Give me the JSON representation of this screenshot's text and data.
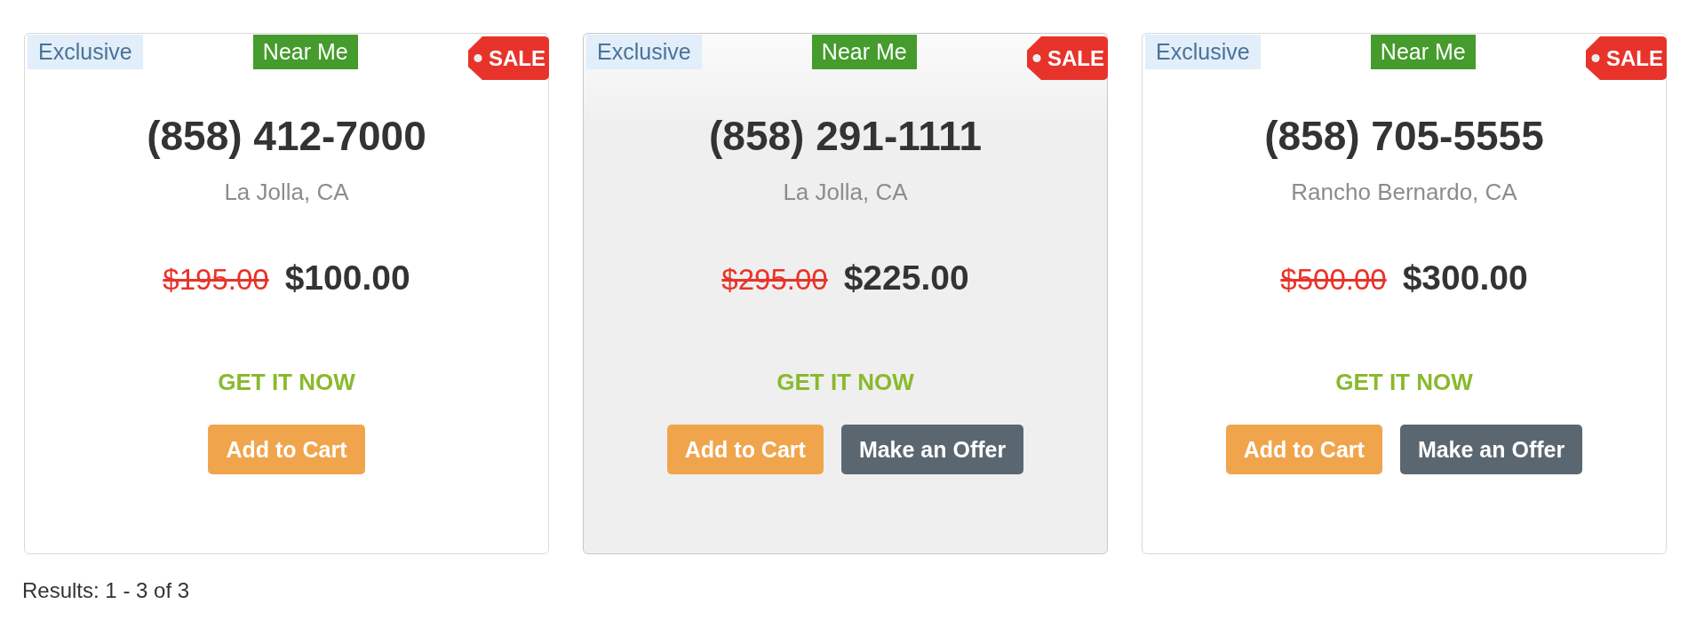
{
  "listings": [
    {
      "highlighted": false,
      "badges": [
        {
          "kind": "exclusive",
          "label": "Exclusive"
        },
        {
          "kind": "near_me",
          "label": "Near Me"
        },
        {
          "kind": "sale",
          "label": "SALE"
        }
      ],
      "phone": "(858) 412-7000",
      "location": "La Jolla, CA",
      "original_price": "$195.00",
      "price": "$100.00",
      "call_to_action": "GET IT NOW",
      "buttons": [
        {
          "kind": "cart",
          "label": "Add to Cart"
        }
      ]
    },
    {
      "highlighted": true,
      "badges": [
        {
          "kind": "exclusive",
          "label": "Exclusive"
        },
        {
          "kind": "near_me",
          "label": "Near Me"
        },
        {
          "kind": "sale",
          "label": "SALE"
        }
      ],
      "phone": "(858) 291-1111",
      "location": "La Jolla, CA",
      "original_price": "$295.00",
      "price": "$225.00",
      "call_to_action": "GET IT NOW",
      "buttons": [
        {
          "kind": "cart",
          "label": "Add to Cart"
        },
        {
          "kind": "offer",
          "label": "Make an Offer"
        }
      ]
    },
    {
      "highlighted": false,
      "badges": [
        {
          "kind": "exclusive",
          "label": "Exclusive"
        },
        {
          "kind": "near_me",
          "label": "Near Me"
        },
        {
          "kind": "sale",
          "label": "SALE"
        }
      ],
      "phone": "(858) 705-5555",
      "location": "Rancho Bernardo, CA",
      "original_price": "$500.00",
      "price": "$300.00",
      "call_to_action": "GET IT NOW",
      "buttons": [
        {
          "kind": "cart",
          "label": "Add to Cart"
        },
        {
          "kind": "offer",
          "label": "Make an Offer"
        }
      ]
    }
  ],
  "results_summary": "Results: 1 - 3 of 3"
}
